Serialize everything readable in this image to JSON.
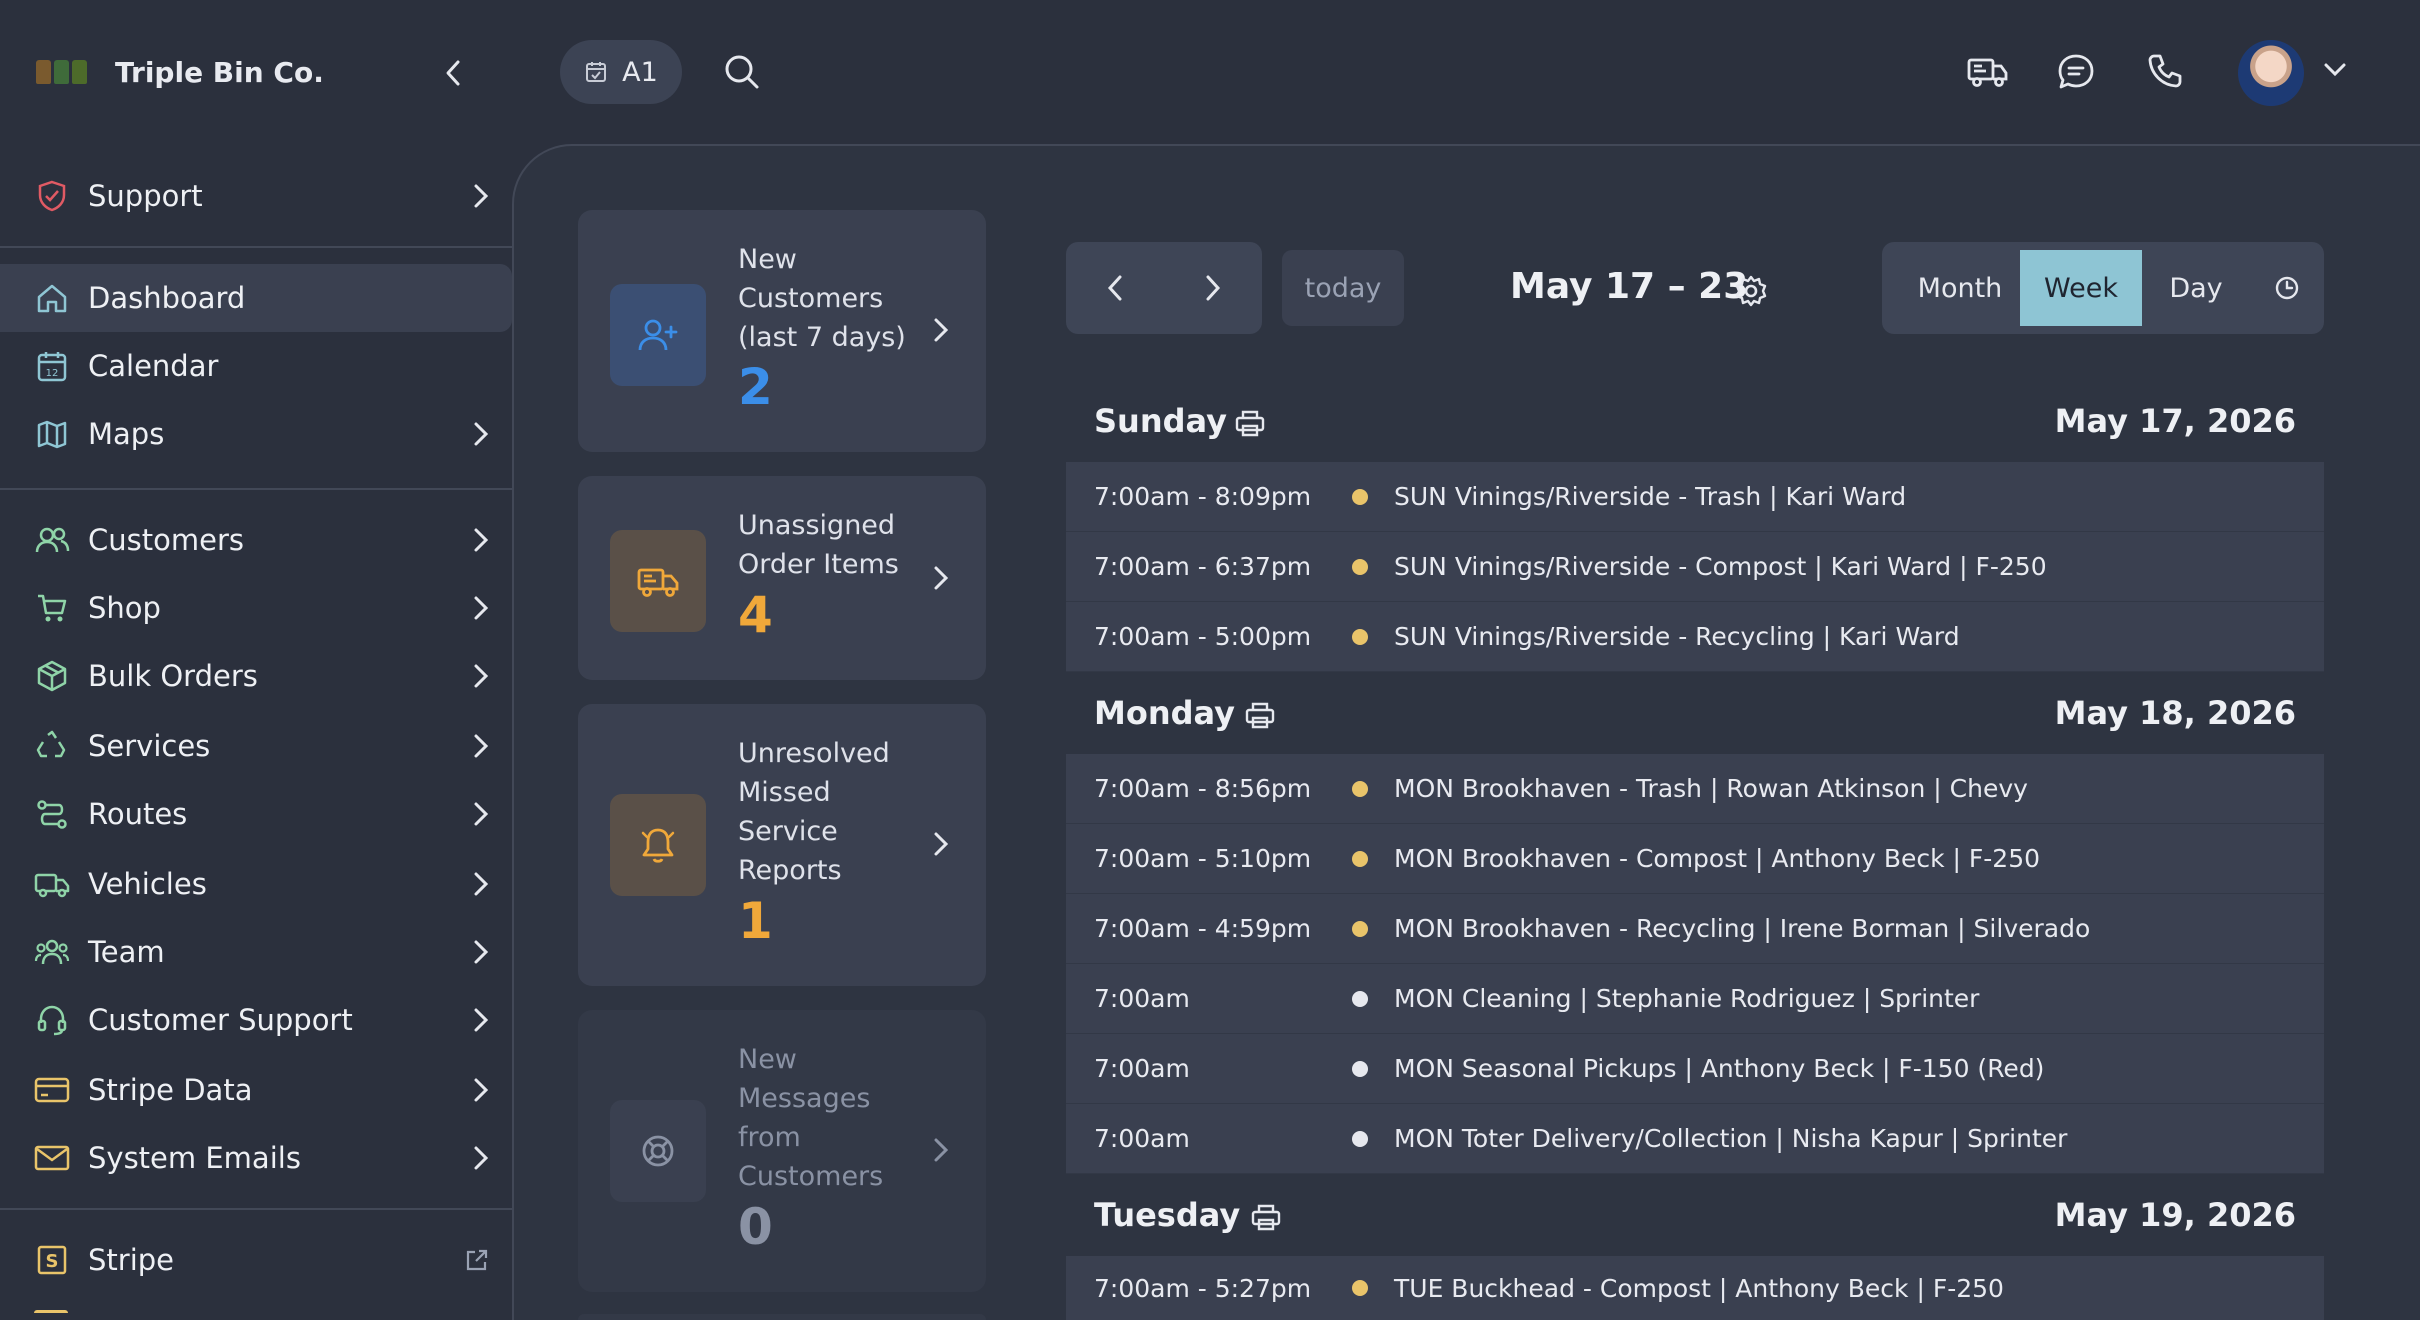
{
  "brand": {
    "name": "Triple Bin Co."
  },
  "colors": {
    "accent_blue": "#3b8ee8",
    "accent_orange": "#f0a83a",
    "event_yellow": "#e9c46a",
    "event_white": "#e6e8ee",
    "active_view": "#8ec5d4"
  },
  "sidebar": {
    "items": [
      {
        "label": "Support",
        "icon": "shield-check-icon"
      },
      {
        "label": "Dashboard",
        "icon": "home-icon"
      },
      {
        "label": "Calendar",
        "icon": "calendar-icon"
      },
      {
        "label": "Maps",
        "icon": "map-icon"
      },
      {
        "label": "Customers",
        "icon": "users-icon"
      },
      {
        "label": "Shop",
        "icon": "cart-icon"
      },
      {
        "label": "Bulk Orders",
        "icon": "box-icon"
      },
      {
        "label": "Services",
        "icon": "recycle-icon"
      },
      {
        "label": "Routes",
        "icon": "route-icon"
      },
      {
        "label": "Vehicles",
        "icon": "truck-icon"
      },
      {
        "label": "Team",
        "icon": "team-icon"
      },
      {
        "label": "Customer Support",
        "icon": "headset-icon"
      },
      {
        "label": "Stripe Data",
        "icon": "card-icon"
      },
      {
        "label": "System Emails",
        "icon": "mail-icon"
      },
      {
        "label": "Stripe",
        "icon": "stripe-s-icon"
      }
    ]
  },
  "topbar": {
    "chip_label": "A1"
  },
  "stats": [
    {
      "label_lines": [
        "New",
        "Customers",
        "(last 7 days)"
      ],
      "value": "2"
    },
    {
      "label_lines": [
        "Unassigned",
        "Order Items"
      ],
      "value": "4"
    },
    {
      "label_lines": [
        "Unresolved",
        "Missed",
        "Service",
        "Reports"
      ],
      "value": "1"
    },
    {
      "label_lines": [
        "New",
        "Messages",
        "from",
        "Customers"
      ],
      "value": "0"
    }
  ],
  "calendar": {
    "today_label": "today",
    "range_title": "May 17 – 23",
    "views": [
      "Month",
      "Week",
      "Day"
    ],
    "active_view": "Week",
    "days": [
      {
        "name": "Sunday",
        "date": "May 17, 2026",
        "events": [
          {
            "time": "7:00am - 8:09pm",
            "title": "SUN Vinings/Riverside - Trash | Kari Ward",
            "dot": "yellow"
          },
          {
            "time": "7:00am - 6:37pm",
            "title": "SUN Vinings/Riverside - Compost | Kari Ward | F-250",
            "dot": "yellow"
          },
          {
            "time": "7:00am - 5:00pm",
            "title": "SUN Vinings/Riverside - Recycling | Kari Ward",
            "dot": "yellow"
          }
        ]
      },
      {
        "name": "Monday",
        "date": "May 18, 2026",
        "events": [
          {
            "time": "7:00am - 8:56pm",
            "title": "MON Brookhaven - Trash | Rowan Atkinson | Chevy",
            "dot": "yellow"
          },
          {
            "time": "7:00am - 5:10pm",
            "title": "MON Brookhaven - Compost | Anthony Beck | F-250",
            "dot": "yellow"
          },
          {
            "time": "7:00am - 4:59pm",
            "title": "MON Brookhaven - Recycling | Irene Borman | Silverado",
            "dot": "yellow"
          },
          {
            "time": "7:00am",
            "title": "MON Cleaning | Stephanie Rodriguez | Sprinter",
            "dot": "white"
          },
          {
            "time": "7:00am",
            "title": "MON Seasonal Pickups | Anthony Beck | F-150 (Red)",
            "dot": "white"
          },
          {
            "time": "7:00am",
            "title": "MON Toter Delivery/Collection | Nisha Kapur | Sprinter",
            "dot": "white"
          }
        ]
      },
      {
        "name": "Tuesday",
        "date": "May 19, 2026",
        "events": [
          {
            "time": "7:00am - 5:27pm",
            "title": "TUE Buckhead - Compost | Anthony Beck | F-250",
            "dot": "yellow"
          }
        ]
      }
    ]
  }
}
